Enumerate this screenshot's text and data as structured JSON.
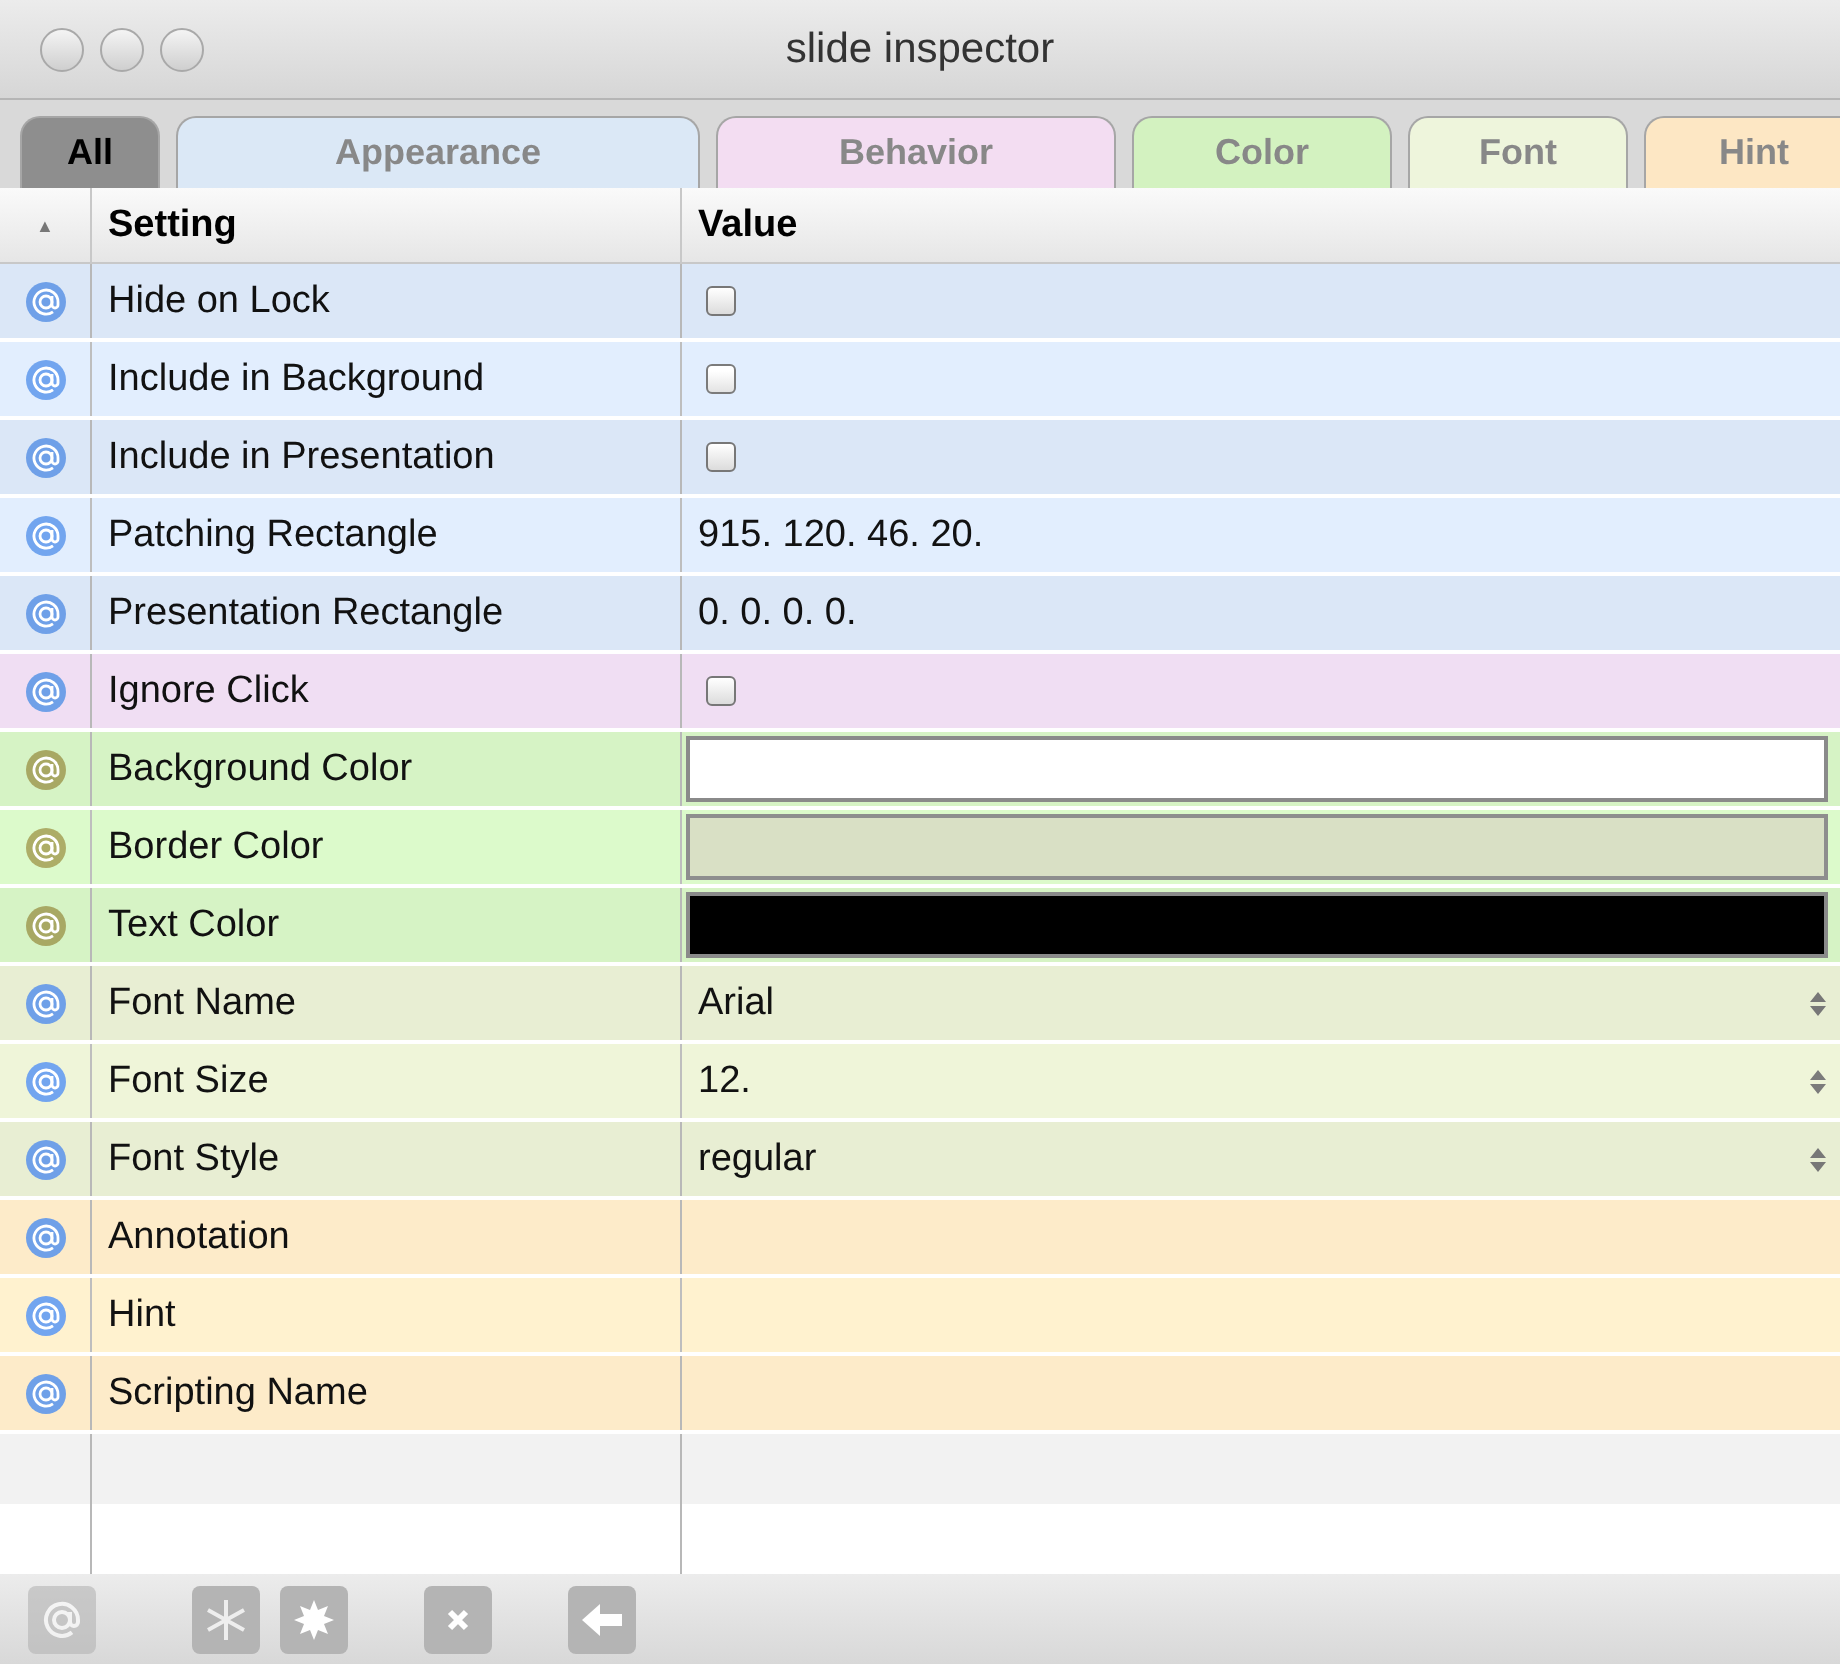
{
  "window": {
    "title": "slide inspector"
  },
  "tabs": [
    {
      "label": "All",
      "color": "#8e8e8e",
      "selected": true
    },
    {
      "label": "Appearance",
      "color": "#dbe8f6",
      "selected": false
    },
    {
      "label": "Behavior",
      "color": "#f3ddf2",
      "selected": false
    },
    {
      "label": "Color",
      "color": "#d3f2c0",
      "selected": false
    },
    {
      "label": "Font",
      "color": "#eef5dc",
      "selected": false
    },
    {
      "label": "Hint",
      "color": "#fde7c4",
      "selected": false
    }
  ],
  "table": {
    "sort_indicator": "▲",
    "columns": [
      "Setting",
      "Value"
    ],
    "groups": [
      {
        "color": "#dbe7f7",
        "rows": [
          {
            "setting": "Hide on Lock",
            "kind": "checkbox",
            "checked": false
          },
          {
            "setting": "Include in Background",
            "kind": "checkbox",
            "checked": false
          },
          {
            "setting": "Include in Presentation",
            "kind": "checkbox",
            "checked": false
          },
          {
            "setting": "Patching Rectangle",
            "kind": "text",
            "value": "915. 120. 46. 20."
          },
          {
            "setting": "Presentation Rectangle",
            "kind": "text",
            "value": "0. 0. 0. 0."
          }
        ]
      },
      {
        "color": "#f0def3",
        "rows": [
          {
            "setting": "Ignore Click",
            "kind": "checkbox",
            "checked": false
          }
        ]
      },
      {
        "color": "#d6f3c5",
        "rows": [
          {
            "setting": "Background Color",
            "kind": "color",
            "color": "#ffffff"
          },
          {
            "setting": "Border Color",
            "kind": "color",
            "color": "#d3d9bf"
          },
          {
            "setting": "Text Color",
            "kind": "color",
            "color": "#000000"
          }
        ]
      },
      {
        "color": "#e8eed3",
        "rows": [
          {
            "setting": "Font Name",
            "kind": "select",
            "value": "Arial"
          },
          {
            "setting": "Font Size",
            "kind": "select",
            "value": "12."
          },
          {
            "setting": "Font Style",
            "kind": "select",
            "value": "regular"
          }
        ]
      },
      {
        "color": "#fdebc9",
        "rows": [
          {
            "setting": "Annotation",
            "kind": "text"
          },
          {
            "setting": "Hint",
            "kind": "text"
          },
          {
            "setting": "Scripting Name",
            "kind": "text"
          }
        ]
      }
    ]
  }
}
